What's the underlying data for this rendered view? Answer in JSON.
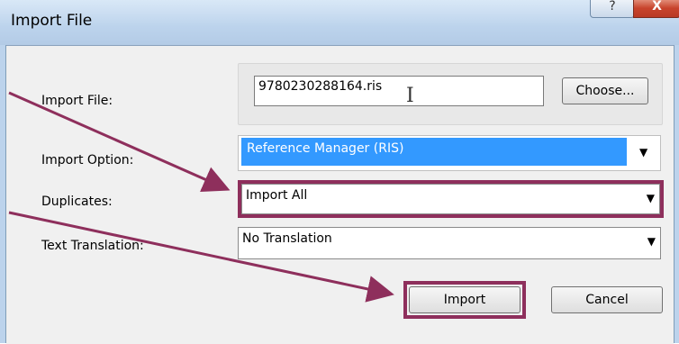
{
  "window": {
    "title": "Import File",
    "help_icon": "?",
    "close_icon": "X"
  },
  "form": {
    "import_file": {
      "label": "Import File:",
      "value": "9780230288164.ris",
      "choose_label": "Choose..."
    },
    "import_option": {
      "label": "Import Option:",
      "value": "Reference Manager (RIS)"
    },
    "duplicates": {
      "label": "Duplicates:",
      "value": "Import All"
    },
    "text_translation": {
      "label": "Text Translation:",
      "value": "No Translation"
    }
  },
  "buttons": {
    "import": "Import",
    "cancel": "Cancel"
  },
  "colors": {
    "highlight": "#8e2f5c",
    "selection": "#3399ff"
  },
  "icons": [
    "help-icon",
    "close-icon",
    "dropdown-arrow-icon",
    "text-cursor-icon",
    "annotation-arrow-icon"
  ]
}
